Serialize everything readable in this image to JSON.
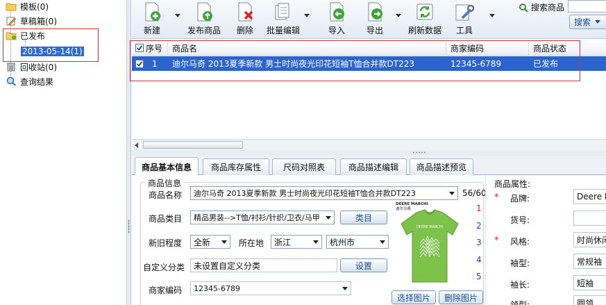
{
  "tree": {
    "items": [
      {
        "label": "模板(0)",
        "icon": "folder-icon"
      },
      {
        "label": "草稿箱(0)",
        "icon": "draft-edit-icon"
      },
      {
        "label": "已发布",
        "icon": "published-folder-icon"
      },
      {
        "label": "2013-05-14(1)",
        "icon": "date-folder-icon"
      },
      {
        "label": "回收站(0)",
        "icon": "trash-icon"
      },
      {
        "label": "查询结果",
        "icon": "search-result-icon"
      }
    ]
  },
  "toolbar": {
    "new_label": "新建",
    "publish_label": "发布商品",
    "delete_label": "删除",
    "batch_edit_label": "批量编辑",
    "import_label": "导入",
    "export_label": "导出",
    "refresh_label": "刷新数据",
    "tools_label": "工具",
    "search_label": "搜索商品",
    "search_button_label": "搜索"
  },
  "grid": {
    "columns": [
      "序号",
      "商品名",
      "商家编码",
      "商品状态"
    ],
    "rows": [
      {
        "index": "1",
        "name": "迪尔马奇 2013夏季新款 男士时尚夜光印花短袖T恤合并款DT223",
        "code": "12345-6789",
        "status": "已发布",
        "checked": true
      }
    ]
  },
  "tabs": [
    "商品基本信息",
    "商品库存属性",
    "尺码对照表",
    "商品描述编辑",
    "商品描述预览"
  ],
  "form": {
    "legend": "商品信息",
    "name_label": "商品名称",
    "name_value": "迪尔马奇 2013夏季新款 男士时尚夜光印花短袖T恤合并款DT223",
    "name_counter": "56/60",
    "category_label": "商品类目",
    "category_value": "精品男装-->T恤/衬衫/针织/卫衣/马甲",
    "category_button": "类目",
    "condition_label": "新旧程度",
    "condition_value": "全新",
    "location_label": "所在地",
    "province_value": "浙江",
    "city_value": "杭州市",
    "custom_category_label": "自定义分类",
    "custom_category_value": "未设置自定义分类",
    "custom_category_button": "设置",
    "merchant_code_label": "商家编码",
    "merchant_code_value": "12345-6789",
    "image_numbers": [
      "1",
      "2",
      "3",
      "4",
      "5"
    ],
    "select_image_button": "选择图片",
    "delete_image_button": "删除图片",
    "image_brand_text": "DEERE MARCHI",
    "image_brand_cn": "迪尔马奇",
    "image_shirt_text": "DEERE MARCHI"
  },
  "properties": {
    "title": "商品属性:",
    "items": [
      {
        "label": "品牌:",
        "value": "Deere Ma",
        "required": true
      },
      {
        "label": "货号:",
        "value": "",
        "required": false
      },
      {
        "label": "风格:",
        "value": "时尚休闲",
        "required": true
      },
      {
        "label": "袖型:",
        "value": "常规袖",
        "required": false
      },
      {
        "label": "袖长:",
        "value": "短袖",
        "required": false
      },
      {
        "label": "领型:",
        "value": "圆领",
        "required": false
      }
    ]
  },
  "colors": {
    "selection_blue": "#2b64cf",
    "highlight_red": "#d9313a",
    "shirt_green": "#7dc24b"
  }
}
